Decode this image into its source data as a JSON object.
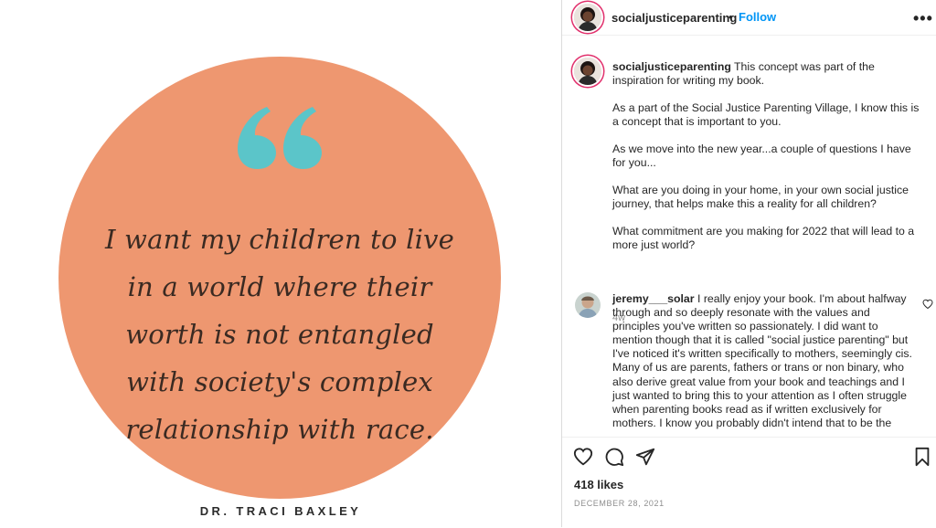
{
  "post_image": {
    "quote": "I want my children to live in a world where their worth is not entangled with society's complex relationship with race.",
    "author": "DR. TRACI BAXLEY",
    "circle_color": "#ee9770",
    "quote_mark_color": "#5bc5c9"
  },
  "header": {
    "username": "socialjusticeparenting",
    "separator": "•",
    "follow_label": "Follow",
    "more_icon": "more-options-icon"
  },
  "caption": {
    "username": "socialjusticeparenting",
    "paragraphs": [
      "This concept was part of the inspiration for writing my book.",
      "As a part of the Social Justice Parenting Village, I know this is a concept that is important to you.",
      "As we move into the new year...a couple of questions I have for you...",
      "What are you doing in your home, in your own social justice journey, that helps make this a reality for all children?",
      "What commitment are you making for 2022 that will lead to a more just world?"
    ],
    "time": "4w"
  },
  "comment": {
    "username": "jeremy___solar",
    "text": "I really enjoy your book. I'm about halfway through and so deeply resonate with the values and principles you've written so passionately. I did want to mention though that it is called \"social justice parenting\" but I've noticed it's written specifically to mothers, seemingly cis. Many of us are parents, fathers or trans or non binary, who also derive great value from your book and teachings and I just wanted to bring this to your attention as I often struggle when parenting books read as if written exclusively for mothers. I know you probably didn't intend that to be the"
  },
  "actions": {
    "likes": "418 likes",
    "date": "DECEMBER 28, 2021"
  },
  "colors": {
    "link_blue": "#0095f6",
    "text_dark": "#262626",
    "text_muted": "#8e8e8e",
    "divider": "#dbdbdb"
  }
}
